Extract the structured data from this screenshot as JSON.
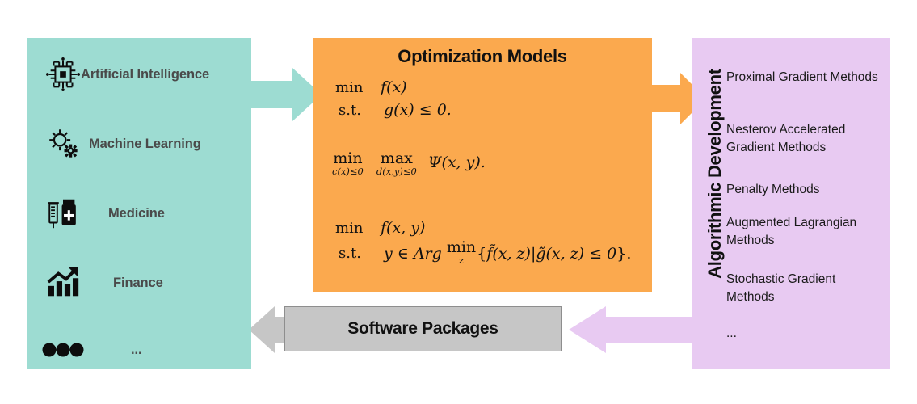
{
  "colors": {
    "teal": "#9ddcd2",
    "orange": "#fba94e",
    "purple": "#e8caf2",
    "grey": "#c6c6c6",
    "grey_border": "#8e8e8e",
    "label_grey": "#4a4a4a",
    "text_black": "#111111",
    "background": "#ffffff"
  },
  "domains": {
    "items": [
      {
        "icon": "cpu-chip-icon",
        "label": "Artificial Intelligence"
      },
      {
        "icon": "gears-icon",
        "label": "Machine Learning"
      },
      {
        "icon": "syringe-vial-icon",
        "label": "Medicine"
      },
      {
        "icon": "bar-chart-growth-icon",
        "label": "Finance"
      },
      {
        "icon": "three-dots-icon",
        "label": "..."
      }
    ]
  },
  "optimization": {
    "title": "Optimization Models",
    "models": [
      {
        "name": "constrained-minimization",
        "lines": [
          {
            "key": "min",
            "body": "f(x)"
          },
          {
            "key": "s.t.",
            "body": "g(x) ≤ 0."
          }
        ]
      },
      {
        "name": "minimax",
        "min_label": "min",
        "min_sub": "c(x)≤0",
        "max_label": "max",
        "max_sub": "d(x,y)≤0",
        "objective": "Ψ(x, y)."
      },
      {
        "name": "bilevel",
        "lines": [
          {
            "key": "min",
            "body": "f(x, y)"
          },
          {
            "key": "s.t.",
            "body": "y ∈ Arg min_z { f̃(x, z) | g̃(x, z) ≤ 0 }."
          }
        ],
        "parts": {
          "min": "min",
          "objective": "f(x, y)",
          "st": "s.t.",
          "membership": "y ∈ Arg",
          "argmin": "min",
          "argmin_sub": "z",
          "open_brace": "{",
          "inner_obj": "f̃(x, z)",
          "bar": "|",
          "inner_con": "g̃(x, z) ≤ 0",
          "close_brace": "}."
        }
      }
    ]
  },
  "algorithms": {
    "title": "Algorithmic Development",
    "items": [
      "Proximal Gradient Methods",
      "Nesterov Accelerated Gradient Methods",
      "Penalty Methods",
      "Augmented Lagrangian Methods",
      "Stochastic Gradient Methods",
      "..."
    ]
  },
  "software": {
    "label": "Software Packages"
  },
  "arrows": [
    {
      "name": "arrow-domains-to-optimization",
      "direction": "right",
      "color": "#9ddcd2"
    },
    {
      "name": "arrow-optimization-to-algorithms",
      "direction": "right",
      "color": "#fba94e"
    },
    {
      "name": "arrow-algorithms-to-software",
      "direction": "left",
      "color": "#e8caf2"
    },
    {
      "name": "arrow-software-to-domains",
      "direction": "left",
      "color": "#c6c6c6"
    }
  ]
}
